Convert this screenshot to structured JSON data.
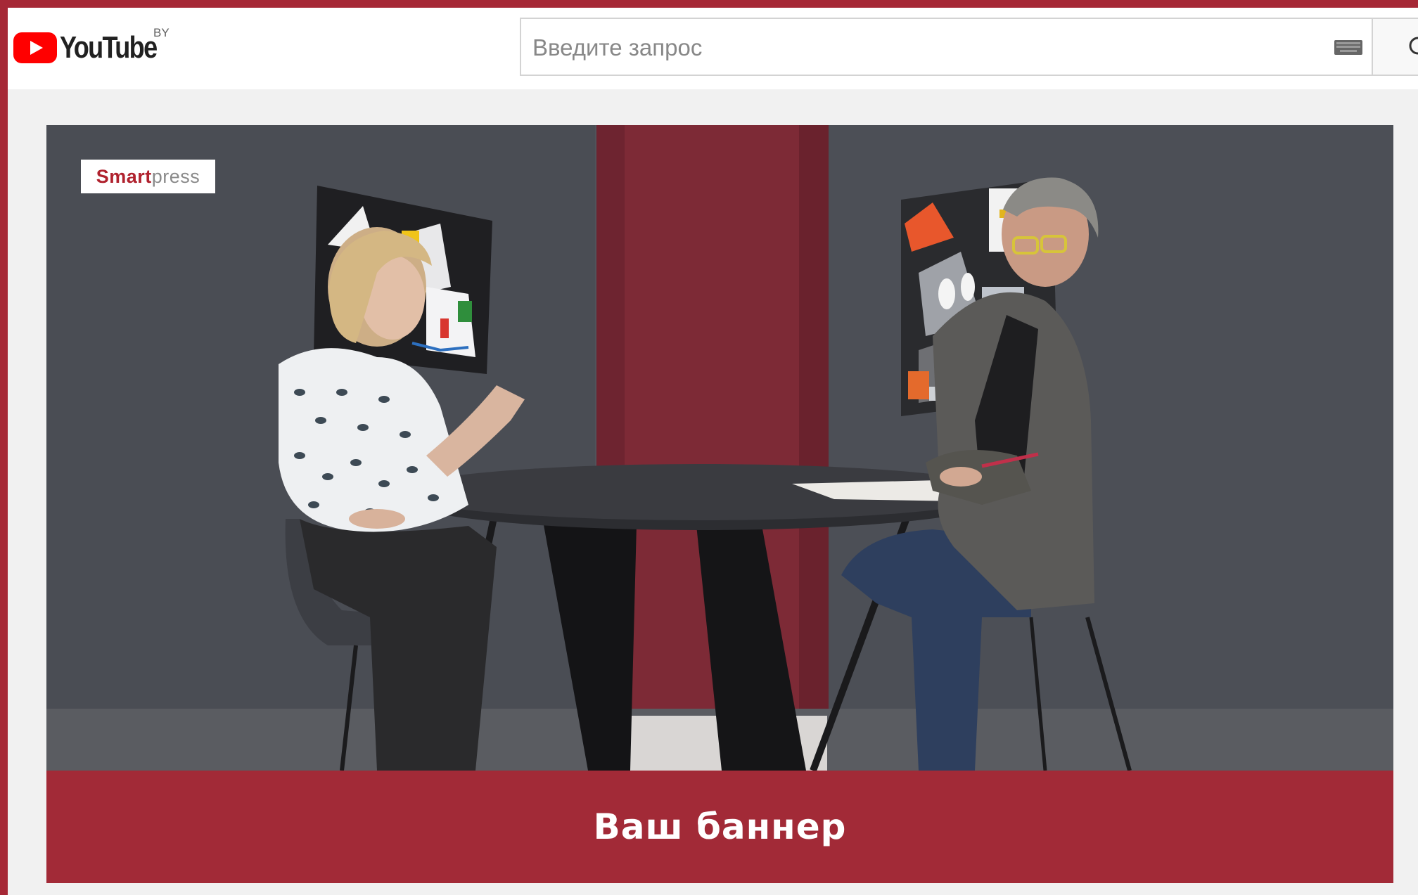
{
  "header": {
    "logo_text": "YouTube",
    "region": "BY",
    "search": {
      "placeholder": "Введите запрос",
      "value": ""
    }
  },
  "video": {
    "brand": {
      "part1": "Smart",
      "part2": "press"
    }
  },
  "banner": {
    "text": "Ваш баннер"
  },
  "colors": {
    "frame": "#a62836",
    "banner": "#a22a37",
    "youtube_red": "#ff0000",
    "brand_red": "#b0222e"
  },
  "icons": [
    "youtube-logo-icon",
    "keyboard-icon",
    "search-icon"
  ]
}
